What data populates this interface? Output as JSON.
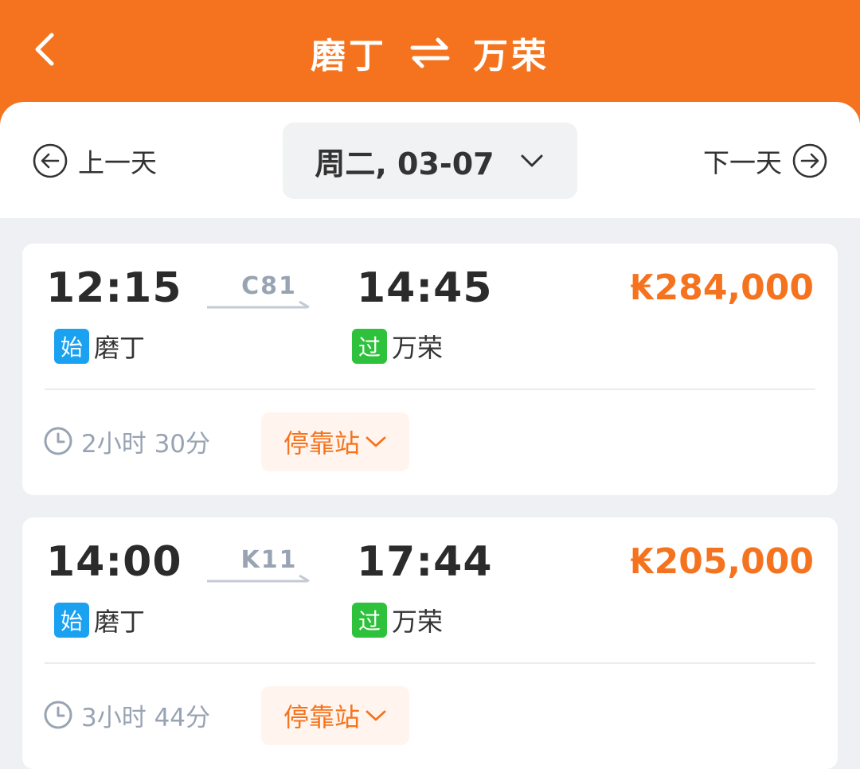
{
  "header": {
    "from": "磨丁",
    "to": "万荣",
    "back_icon": "chevron-left-icon",
    "swap_icon": "swap-arrows-icon",
    "bg_color": "#f5731e"
  },
  "date_bar": {
    "prev_label": "上一天",
    "next_label": "下一天",
    "current_date": "周二, 03-07",
    "prev_icon": "circle-arrow-left-icon",
    "next_icon": "circle-arrow-right-icon",
    "dropdown_icon": "chevron-down-icon"
  },
  "trains": [
    {
      "depart_time": "12:15",
      "train_no": "C81",
      "arrive_time": "14:45",
      "price": "₭284,000",
      "depart_badge": "始",
      "depart_station": "磨丁",
      "arrive_badge": "过",
      "arrive_station": "万荣",
      "duration": "2小时 30分",
      "stops_label": "停靠站"
    },
    {
      "depart_time": "14:00",
      "train_no": "K11",
      "arrive_time": "17:44",
      "price": "₭205,000",
      "depart_badge": "始",
      "depart_station": "磨丁",
      "arrive_badge": "过",
      "arrive_station": "万荣",
      "duration": "3小时 44分",
      "stops_label": "停靠站"
    }
  ],
  "colors": {
    "accent": "#f5731e",
    "badge_start": "#1aa1f0",
    "badge_pass": "#2ec23c",
    "muted": "#98a3b3"
  }
}
